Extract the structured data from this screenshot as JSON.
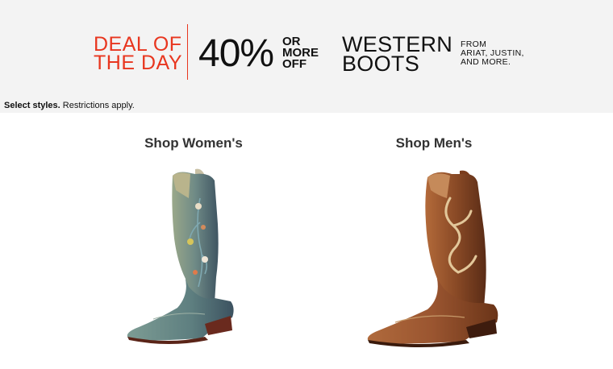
{
  "banner": {
    "deal_line1": "DEAL OF",
    "deal_line2": "THE DAY",
    "percent": "40%",
    "or": "OR",
    "more": "MORE",
    "off": "OFF",
    "western": "WESTERN",
    "boots": "BOOTS",
    "from1": "FROM",
    "from2": "ARIAT, JUSTIN,",
    "from3": "AND MORE.",
    "accent_color": "#e8361f"
  },
  "restrictions": {
    "bold": "Select styles.",
    "text": "Restrictions apply."
  },
  "shop": {
    "women_label": "Shop Women's",
    "men_label": "Shop Men's"
  }
}
